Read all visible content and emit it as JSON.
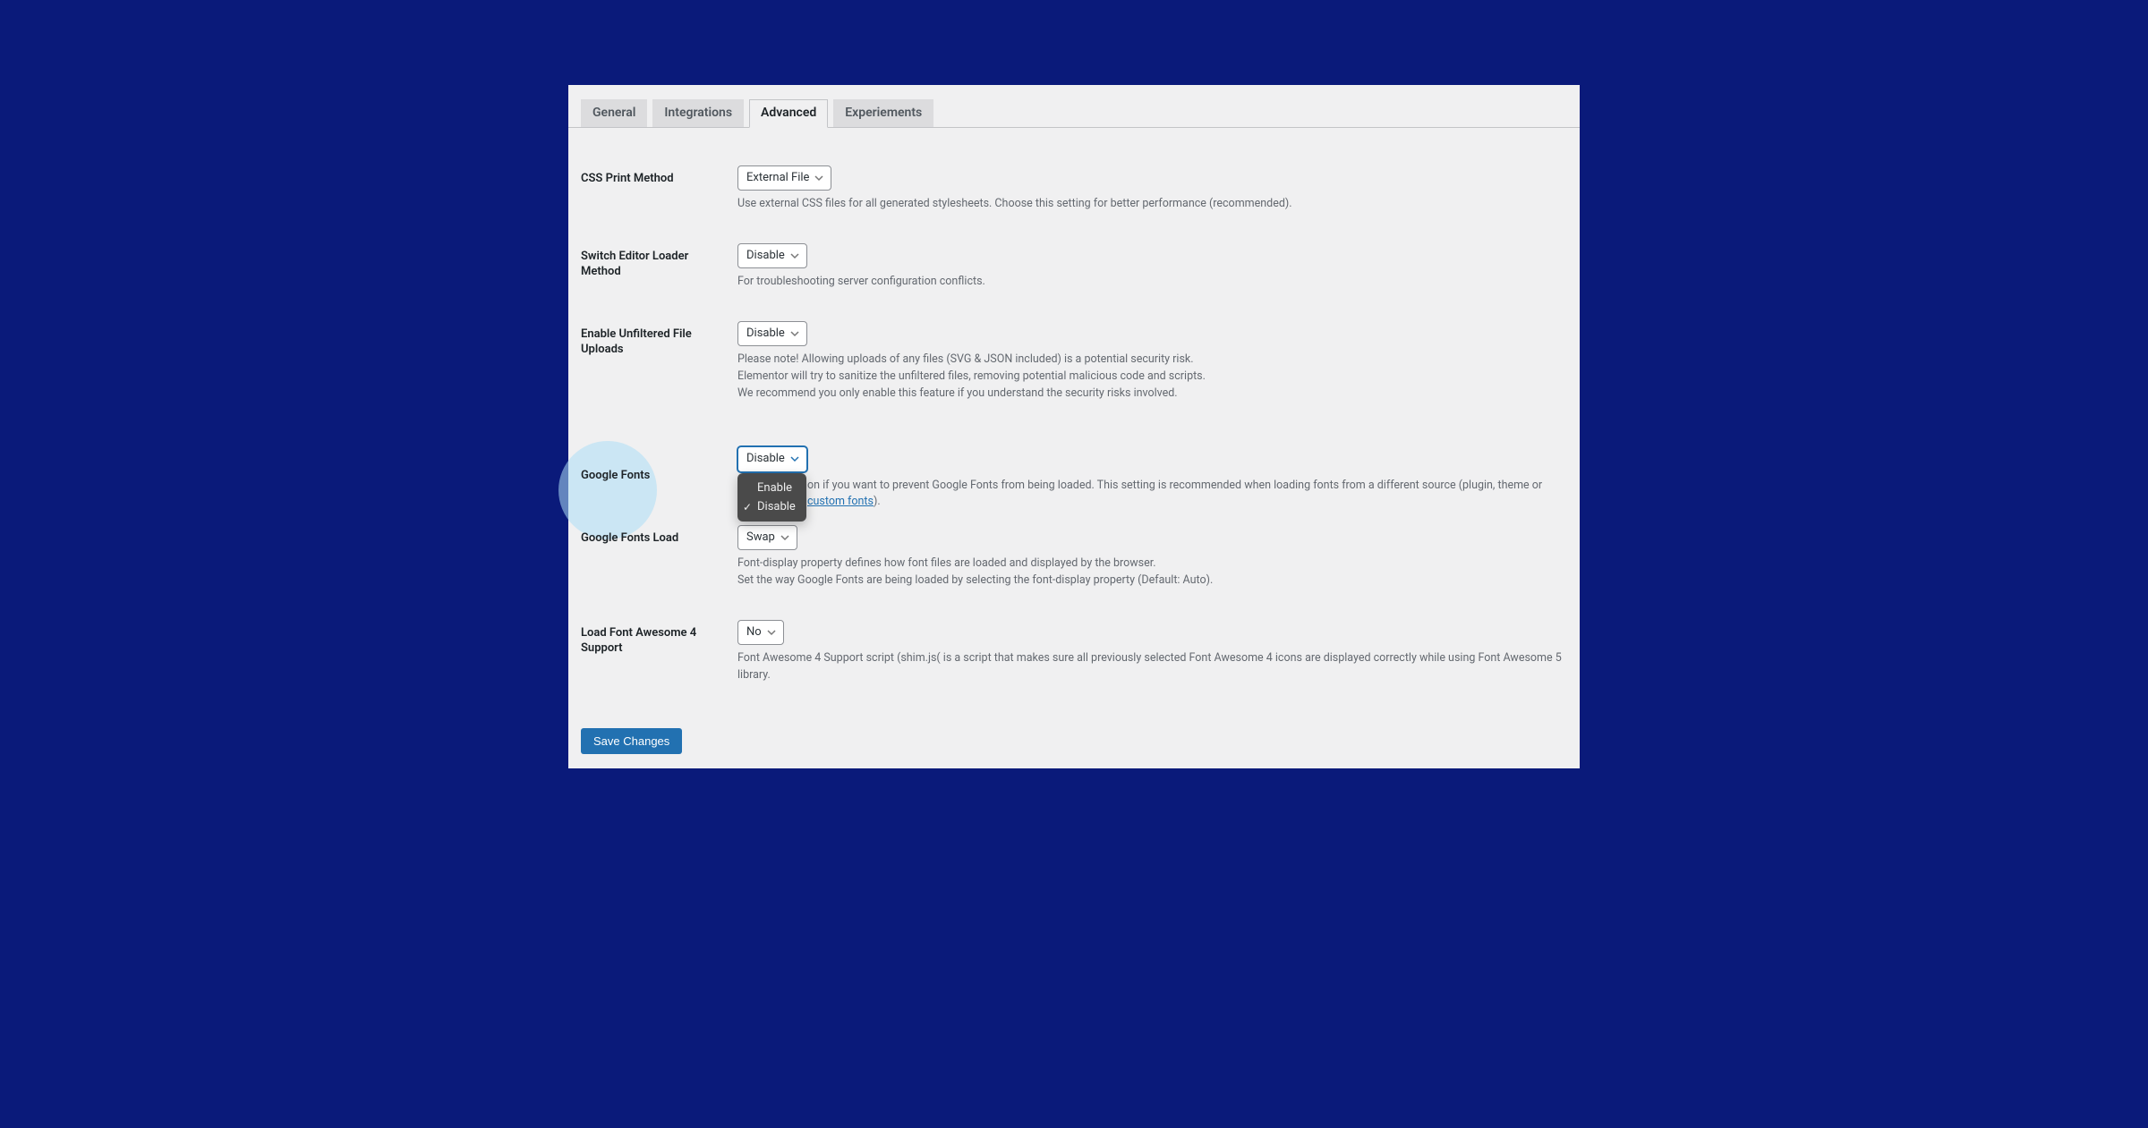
{
  "tabs": {
    "general": "General",
    "integrations": "Integrations",
    "advanced": "Advanced",
    "experiments": "Experiements"
  },
  "settings": {
    "css_print": {
      "label": "CSS Print Method",
      "value": "External File",
      "desc": "Use external CSS files for all generated stylesheets. Choose this setting for better performance (recommended)."
    },
    "switch_editor": {
      "label": "Switch Editor Loader Method",
      "value": "Disable",
      "desc": "For troubleshooting server configuration conflicts."
    },
    "unfiltered_uploads": {
      "label": "Enable Unfiltered File Uploads",
      "value": "Disable",
      "desc_line1": "Please note! Allowing uploads of any files (SVG & JSON included) is a potential security risk.",
      "desc_line2": "Elementor will try to sanitize the unfiltered files, removing potential malicious code and scripts.",
      "desc_line3": "We recommend you only enable this feature if you understand the security risks involved."
    },
    "google_fonts": {
      "label": "Google Fonts",
      "value": "Disable",
      "option_enable": "Enable",
      "option_disable": "Disable",
      "desc_part1": "on if you want to prevent Google Fonts from being loaded. This setting is recommended when loading fonts from a different source (plugin, theme or ",
      "desc_link": "custom fonts",
      "desc_part2": ")."
    },
    "google_fonts_load": {
      "label": "Google Fonts Load",
      "value": "Swap",
      "desc_line1": "Font-display property defines how font files are loaded and displayed by the browser.",
      "desc_line2": "Set the way Google Fonts are being loaded by selecting the font-display property (Default: Auto)."
    },
    "fa4_support": {
      "label": "Load Font Awesome 4 Support",
      "value": "No",
      "desc": "Font Awesome 4 Support script (shim.js( is a script that makes sure all previously selected Font Awesome 4 icons are displayed correctly while using Font Awesome 5 library."
    }
  },
  "buttons": {
    "save": "Save Changes"
  }
}
